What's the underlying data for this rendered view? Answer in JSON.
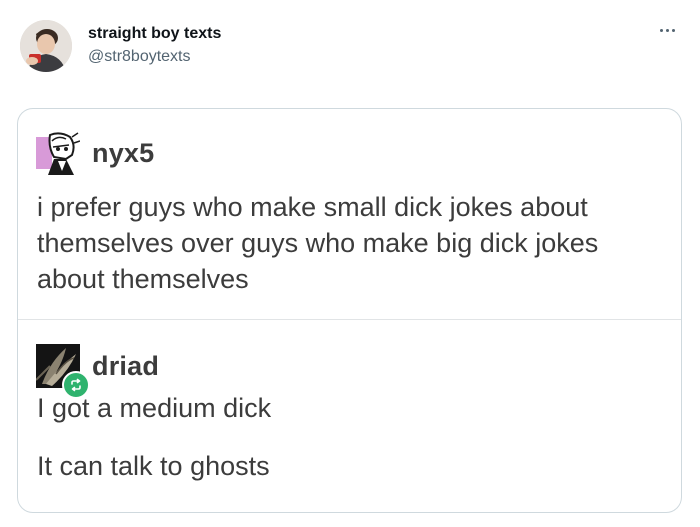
{
  "tweet": {
    "display_name": "straight boy texts",
    "handle": "@str8boytexts",
    "more_icon": "more-horizontal-icon"
  },
  "media": {
    "posts": [
      {
        "username": "nyx5",
        "text": "i prefer guys who make small dick jokes about themselves over guys who make big dick jokes about themselves"
      },
      {
        "username": "driad",
        "reblog_icon": "reblog-icon",
        "reblog_color": "#2fb36e",
        "lines": [
          "I got a medium dick",
          "It can talk to ghosts"
        ]
      }
    ]
  }
}
